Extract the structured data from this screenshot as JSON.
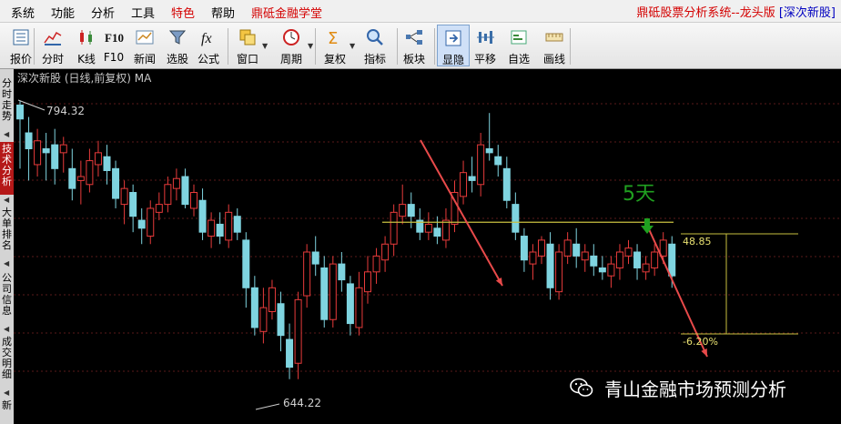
{
  "menubar": {
    "items": [
      {
        "label": "系统",
        "red": false
      },
      {
        "label": "功能",
        "red": false
      },
      {
        "label": "分析",
        "red": false
      },
      {
        "label": "工具",
        "red": false
      },
      {
        "label": "特色",
        "red": true
      },
      {
        "label": "帮助",
        "red": false
      },
      {
        "label": "鼎砥金融学堂",
        "red": true
      }
    ],
    "title_main": "鼎砥股票分析系统--龙头版",
    "title_sub": "[深次新股]"
  },
  "toolbar": {
    "buttons": [
      {
        "label": "报价",
        "icon": "quote-icon"
      },
      {
        "label": "分时",
        "icon": "intraday-icon"
      },
      {
        "label": "K线",
        "icon": "candlestick-icon"
      },
      {
        "label": "F10",
        "icon": "f10-icon"
      },
      {
        "label": "新闻",
        "icon": "news-icon"
      },
      {
        "label": "选股",
        "icon": "stock-filter-icon"
      },
      {
        "label": "公式",
        "icon": "formula-icon"
      },
      {
        "label": "窗口",
        "icon": "window-icon"
      },
      {
        "label": "周期",
        "icon": "period-icon"
      },
      {
        "label": "复权",
        "icon": "adjust-icon"
      },
      {
        "label": "指标",
        "icon": "indicator-icon"
      },
      {
        "label": "板块",
        "icon": "sector-icon"
      },
      {
        "label": "显隐",
        "icon": "show-hide-icon",
        "selected": true
      },
      {
        "label": "平移",
        "icon": "pan-icon"
      },
      {
        "label": "自选",
        "icon": "watchlist-icon"
      },
      {
        "label": "画线",
        "icon": "draw-line-icon"
      }
    ]
  },
  "side_tabs": [
    {
      "label": "分时走势",
      "active": false
    },
    {
      "label": "技术分析",
      "active": true
    },
    {
      "label": "大单排名",
      "active": false
    },
    {
      "label": "公司信息",
      "active": false
    },
    {
      "label": "成交明细",
      "active": false
    },
    {
      "label": "新",
      "active": false
    }
  ],
  "chart_header": "深次新股 (日线,前复权) MA",
  "colors": {
    "up": "#e83b3b",
    "down": "#7fd4e0",
    "line": "#c8c040",
    "arrow": "#e84a4a",
    "green": "#20a020",
    "grid": "#5a1a1a"
  },
  "chart_data": {
    "type": "candlestick",
    "title": "深次新股 (日线,前复权) MA",
    "high_label": "794.32",
    "low_label": "644.22",
    "annotation_days": "5天",
    "range_top_label": "48.85",
    "range_bottom_label": "-6.20%",
    "ylim": [
      636,
      800
    ],
    "support_level": 733,
    "candles": [
      [
        792,
        785,
        794,
        760
      ],
      [
        778,
        770,
        786,
        754
      ],
      [
        762,
        774,
        780,
        756
      ],
      [
        770,
        768,
        778,
        754
      ],
      [
        772,
        760,
        780,
        752
      ],
      [
        768,
        772,
        776,
        758
      ],
      [
        760,
        750,
        770,
        744
      ],
      [
        754,
        756,
        764,
        742
      ],
      [
        752,
        764,
        770,
        748
      ],
      [
        762,
        768,
        774,
        756
      ],
      [
        766,
        759,
        772,
        752
      ],
      [
        760,
        745,
        764,
        740
      ],
      [
        742,
        750,
        754,
        732
      ],
      [
        748,
        736,
        752,
        728
      ],
      [
        734,
        730,
        740,
        722
      ],
      [
        726,
        740,
        744,
        722
      ],
      [
        738,
        742,
        748,
        734
      ],
      [
        742,
        752,
        756,
        738
      ],
      [
        750,
        755,
        760,
        744
      ],
      [
        756,
        742,
        760,
        740
      ],
      [
        740,
        748,
        752,
        736
      ],
      [
        744,
        728,
        750,
        724
      ],
      [
        726,
        734,
        738,
        720
      ],
      [
        732,
        726,
        738,
        722
      ],
      [
        724,
        738,
        742,
        720
      ],
      [
        736,
        728,
        740,
        724
      ],
      [
        724,
        700,
        728,
        690
      ],
      [
        700,
        680,
        706,
        676
      ],
      [
        678,
        690,
        700,
        672
      ],
      [
        688,
        700,
        704,
        684
      ],
      [
        692,
        676,
        698,
        668
      ],
      [
        674,
        660,
        682,
        654
      ],
      [
        662,
        694,
        698,
        654
      ],
      [
        696,
        718,
        722,
        690
      ],
      [
        718,
        712,
        726,
        706
      ],
      [
        710,
        684,
        716,
        680
      ],
      [
        684,
        712,
        716,
        680
      ],
      [
        712,
        704,
        718,
        698
      ],
      [
        702,
        682,
        706,
        676
      ],
      [
        680,
        700,
        708,
        676
      ],
      [
        698,
        708,
        716,
        692
      ],
      [
        708,
        716,
        720,
        702
      ],
      [
        714,
        722,
        726,
        708
      ],
      [
        722,
        738,
        742,
        716
      ],
      [
        736,
        742,
        752,
        732
      ],
      [
        742,
        736,
        748,
        730
      ],
      [
        734,
        728,
        740,
        724
      ],
      [
        728,
        732,
        738,
        724
      ],
      [
        730,
        726,
        736,
        722
      ],
      [
        724,
        734,
        740,
        720
      ],
      [
        732,
        748,
        754,
        728
      ],
      [
        746,
        758,
        764,
        742
      ],
      [
        756,
        754,
        766,
        748
      ],
      [
        752,
        772,
        778,
        746
      ],
      [
        770,
        768,
        788,
        764
      ],
      [
        766,
        762,
        772,
        756
      ],
      [
        760,
        744,
        766,
        740
      ],
      [
        742,
        728,
        748,
        724
      ],
      [
        726,
        714,
        730,
        708
      ],
      [
        712,
        718,
        722,
        704
      ],
      [
        716,
        724,
        726,
        712
      ],
      [
        722,
        700,
        728,
        694
      ],
      [
        698,
        718,
        722,
        694
      ],
      [
        716,
        724,
        728,
        712
      ],
      [
        722,
        716,
        730,
        710
      ],
      [
        714,
        718,
        722,
        708
      ],
      [
        716,
        711,
        722,
        706
      ],
      [
        710,
        708,
        716,
        704
      ],
      [
        706,
        712,
        716,
        700
      ],
      [
        710,
        718,
        722,
        704
      ],
      [
        716,
        720,
        724,
        712
      ],
      [
        718,
        710,
        722,
        704
      ],
      [
        708,
        712,
        716,
        704
      ],
      [
        710,
        718,
        722,
        706
      ],
      [
        716,
        724,
        728,
        712
      ],
      [
        722,
        706,
        726,
        700
      ]
    ]
  }
}
